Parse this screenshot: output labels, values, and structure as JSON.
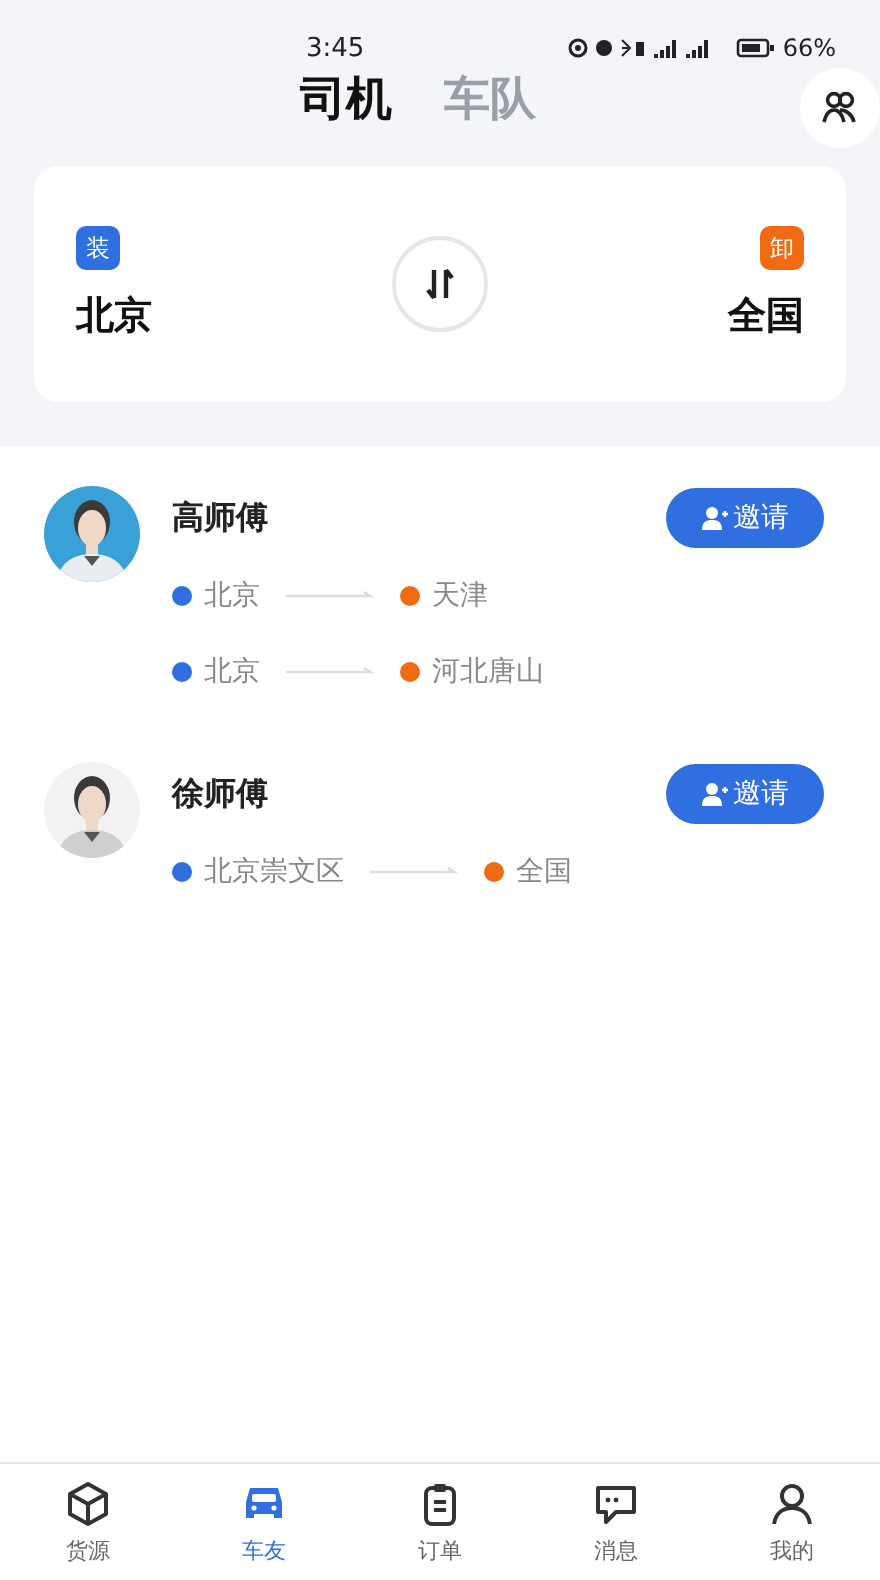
{
  "status_bar": {
    "time": "3:45",
    "battery": "66%"
  },
  "tabs": [
    {
      "label": "司机",
      "selected": true
    },
    {
      "label": "车队",
      "selected": false
    }
  ],
  "route_picker": {
    "load": {
      "badge": "装",
      "city": "北京"
    },
    "unload": {
      "badge": "卸",
      "city": "全国"
    }
  },
  "drivers": [
    {
      "name": "高师傅",
      "button": "邀请",
      "avatar": {
        "kind": "picture"
      },
      "routes": [
        {
          "from": "北京",
          "to": "天津"
        },
        {
          "from": "北京",
          "to": "河北唐山"
        }
      ]
    },
    {
      "name": "徐师傅",
      "button": "邀请",
      "avatar": {
        "kind": "picture"
      },
      "routes": [
        {
          "from": "北京崇文区",
          "to": "全国"
        }
      ]
    }
  ],
  "bottom_nav": [
    {
      "label": "货源",
      "kind": "box",
      "selected": false
    },
    {
      "label": "车友",
      "kind": "car",
      "selected": true
    },
    {
      "label": "订单",
      "kind": "clipboard",
      "selected": false
    },
    {
      "label": "消息",
      "kind": "chat",
      "selected": false
    },
    {
      "label": "我的",
      "kind": "person",
      "selected": false
    }
  ]
}
